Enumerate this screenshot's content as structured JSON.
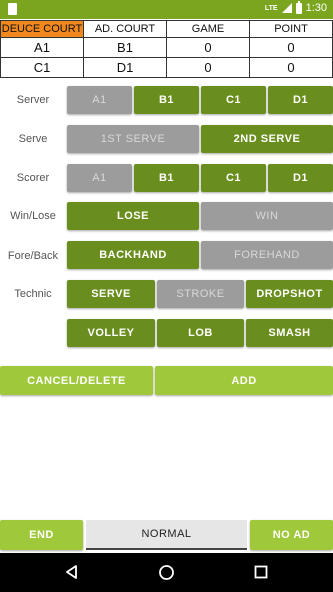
{
  "status_bar": {
    "network": "LTE",
    "time": "1:30"
  },
  "score_table": {
    "headers": [
      "DEUCE COURT",
      "AD. COURT",
      "GAME",
      "POINT"
    ],
    "rows": [
      [
        "A1",
        "B1",
        "0",
        "0"
      ],
      [
        "C1",
        "D1",
        "0",
        "0"
      ]
    ]
  },
  "labels": {
    "server": "Server",
    "serve": "Serve",
    "scorer": "Scorer",
    "win_lose": "Win/Lose",
    "fore_back": "Fore/Back",
    "technic": "Technic"
  },
  "server": {
    "options": [
      "A1",
      "B1",
      "C1",
      "D1"
    ],
    "selected": "A1"
  },
  "serve": {
    "options": [
      "1ST SERVE",
      "2ND SERVE"
    ],
    "selected": "1ST SERVE"
  },
  "scorer": {
    "options": [
      "A1",
      "B1",
      "C1",
      "D1"
    ],
    "selected": "A1"
  },
  "win_lose": {
    "options": [
      "LOSE",
      "WIN"
    ],
    "selected": "WIN"
  },
  "fore_back": {
    "options": [
      "BACKHAND",
      "FOREHAND"
    ],
    "selected": "FOREHAND"
  },
  "technic": {
    "options": [
      "SERVE",
      "STROKE",
      "DROPSHOT",
      "VOLLEY",
      "LOB",
      "SMASH"
    ],
    "selected": "STROKE"
  },
  "actions": {
    "cancel_delete": "CANCEL/DELETE",
    "add": "ADD"
  },
  "bottom": {
    "end": "END",
    "mode": "NORMAL",
    "no_ad": "NO AD"
  },
  "colors": {
    "accent": "#7ba51f",
    "button_on": "#6a8e1e",
    "button_off": "#9c9c9c",
    "button_light": "#9fc83a",
    "deuce_header": "#f0881e"
  }
}
